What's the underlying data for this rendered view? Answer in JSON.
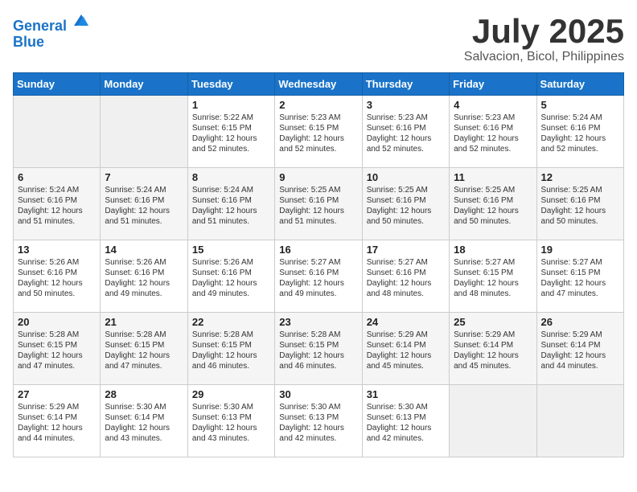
{
  "header": {
    "logo_line1": "General",
    "logo_line2": "Blue",
    "main_title": "July 2025",
    "subtitle": "Salvacion, Bicol, Philippines"
  },
  "weekdays": [
    "Sunday",
    "Monday",
    "Tuesday",
    "Wednesday",
    "Thursday",
    "Friday",
    "Saturday"
  ],
  "weeks": [
    [
      {
        "day": "",
        "info": ""
      },
      {
        "day": "",
        "info": ""
      },
      {
        "day": "1",
        "info": "Sunrise: 5:22 AM\nSunset: 6:15 PM\nDaylight: 12 hours and 52 minutes."
      },
      {
        "day": "2",
        "info": "Sunrise: 5:23 AM\nSunset: 6:15 PM\nDaylight: 12 hours and 52 minutes."
      },
      {
        "day": "3",
        "info": "Sunrise: 5:23 AM\nSunset: 6:16 PM\nDaylight: 12 hours and 52 minutes."
      },
      {
        "day": "4",
        "info": "Sunrise: 5:23 AM\nSunset: 6:16 PM\nDaylight: 12 hours and 52 minutes."
      },
      {
        "day": "5",
        "info": "Sunrise: 5:24 AM\nSunset: 6:16 PM\nDaylight: 12 hours and 52 minutes."
      }
    ],
    [
      {
        "day": "6",
        "info": "Sunrise: 5:24 AM\nSunset: 6:16 PM\nDaylight: 12 hours and 51 minutes."
      },
      {
        "day": "7",
        "info": "Sunrise: 5:24 AM\nSunset: 6:16 PM\nDaylight: 12 hours and 51 minutes."
      },
      {
        "day": "8",
        "info": "Sunrise: 5:24 AM\nSunset: 6:16 PM\nDaylight: 12 hours and 51 minutes."
      },
      {
        "day": "9",
        "info": "Sunrise: 5:25 AM\nSunset: 6:16 PM\nDaylight: 12 hours and 51 minutes."
      },
      {
        "day": "10",
        "info": "Sunrise: 5:25 AM\nSunset: 6:16 PM\nDaylight: 12 hours and 50 minutes."
      },
      {
        "day": "11",
        "info": "Sunrise: 5:25 AM\nSunset: 6:16 PM\nDaylight: 12 hours and 50 minutes."
      },
      {
        "day": "12",
        "info": "Sunrise: 5:25 AM\nSunset: 6:16 PM\nDaylight: 12 hours and 50 minutes."
      }
    ],
    [
      {
        "day": "13",
        "info": "Sunrise: 5:26 AM\nSunset: 6:16 PM\nDaylight: 12 hours and 50 minutes."
      },
      {
        "day": "14",
        "info": "Sunrise: 5:26 AM\nSunset: 6:16 PM\nDaylight: 12 hours and 49 minutes."
      },
      {
        "day": "15",
        "info": "Sunrise: 5:26 AM\nSunset: 6:16 PM\nDaylight: 12 hours and 49 minutes."
      },
      {
        "day": "16",
        "info": "Sunrise: 5:27 AM\nSunset: 6:16 PM\nDaylight: 12 hours and 49 minutes."
      },
      {
        "day": "17",
        "info": "Sunrise: 5:27 AM\nSunset: 6:16 PM\nDaylight: 12 hours and 48 minutes."
      },
      {
        "day": "18",
        "info": "Sunrise: 5:27 AM\nSunset: 6:15 PM\nDaylight: 12 hours and 48 minutes."
      },
      {
        "day": "19",
        "info": "Sunrise: 5:27 AM\nSunset: 6:15 PM\nDaylight: 12 hours and 47 minutes."
      }
    ],
    [
      {
        "day": "20",
        "info": "Sunrise: 5:28 AM\nSunset: 6:15 PM\nDaylight: 12 hours and 47 minutes."
      },
      {
        "day": "21",
        "info": "Sunrise: 5:28 AM\nSunset: 6:15 PM\nDaylight: 12 hours and 47 minutes."
      },
      {
        "day": "22",
        "info": "Sunrise: 5:28 AM\nSunset: 6:15 PM\nDaylight: 12 hours and 46 minutes."
      },
      {
        "day": "23",
        "info": "Sunrise: 5:28 AM\nSunset: 6:15 PM\nDaylight: 12 hours and 46 minutes."
      },
      {
        "day": "24",
        "info": "Sunrise: 5:29 AM\nSunset: 6:14 PM\nDaylight: 12 hours and 45 minutes."
      },
      {
        "day": "25",
        "info": "Sunrise: 5:29 AM\nSunset: 6:14 PM\nDaylight: 12 hours and 45 minutes."
      },
      {
        "day": "26",
        "info": "Sunrise: 5:29 AM\nSunset: 6:14 PM\nDaylight: 12 hours and 44 minutes."
      }
    ],
    [
      {
        "day": "27",
        "info": "Sunrise: 5:29 AM\nSunset: 6:14 PM\nDaylight: 12 hours and 44 minutes."
      },
      {
        "day": "28",
        "info": "Sunrise: 5:30 AM\nSunset: 6:14 PM\nDaylight: 12 hours and 43 minutes."
      },
      {
        "day": "29",
        "info": "Sunrise: 5:30 AM\nSunset: 6:13 PM\nDaylight: 12 hours and 43 minutes."
      },
      {
        "day": "30",
        "info": "Sunrise: 5:30 AM\nSunset: 6:13 PM\nDaylight: 12 hours and 42 minutes."
      },
      {
        "day": "31",
        "info": "Sunrise: 5:30 AM\nSunset: 6:13 PM\nDaylight: 12 hours and 42 minutes."
      },
      {
        "day": "",
        "info": ""
      },
      {
        "day": "",
        "info": ""
      }
    ]
  ]
}
